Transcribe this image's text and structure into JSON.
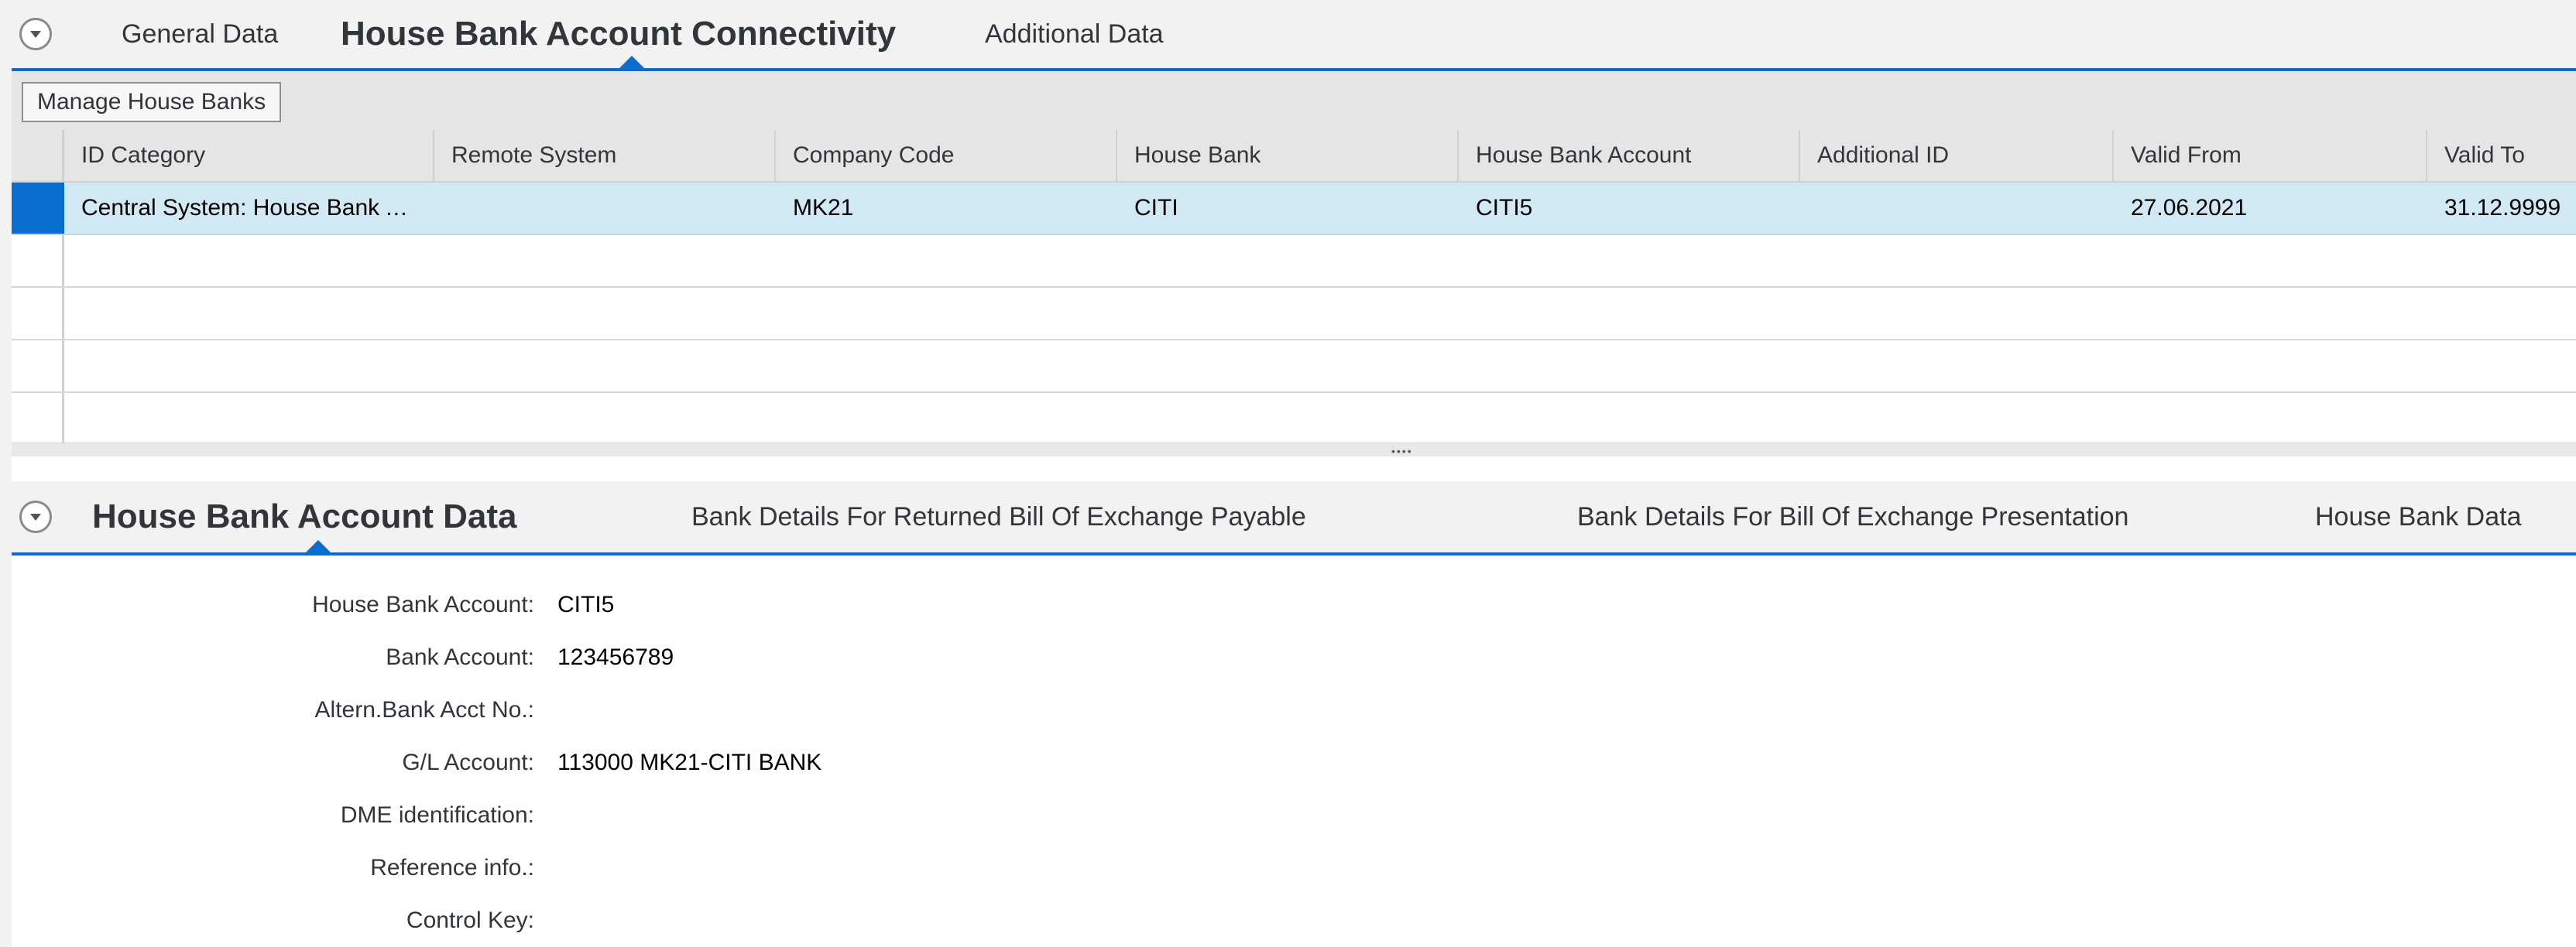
{
  "top_tabs": {
    "items": [
      {
        "label": "General Data"
      },
      {
        "label": "House Bank Account Connectivity"
      },
      {
        "label": "Additional Data"
      }
    ],
    "active_index": 1
  },
  "toolbar": {
    "manage_label": "Manage House Banks"
  },
  "table": {
    "columns": [
      "ID Category",
      "Remote System",
      "Company Code",
      "House Bank",
      "House Bank Account",
      "Additional ID",
      "Valid From",
      "Valid To"
    ],
    "rows": [
      [
        "Central System: House Bank Account",
        "",
        "MK21",
        "CITI",
        "CITI5",
        "",
        "27.06.2021",
        "31.12.9999"
      ]
    ],
    "selected_row": 0,
    "empty_rows": 4
  },
  "bottom_tabs": {
    "items": [
      {
        "label": "House Bank Account Data"
      },
      {
        "label": "Bank Details For Returned Bill Of Exchange Payable"
      },
      {
        "label": "Bank Details For Bill Of Exchange Presentation"
      },
      {
        "label": "House Bank Data"
      }
    ],
    "active_index": 0
  },
  "form": {
    "fields": [
      {
        "label": "House Bank Account:",
        "value": "CITI5"
      },
      {
        "label": "Bank Account:",
        "value": "123456789"
      },
      {
        "label": "Altern.Bank Acct No.:",
        "value": ""
      },
      {
        "label": "G/L Account:",
        "value": "113000 MK21-CITI BANK"
      },
      {
        "label": "DME identification:",
        "value": ""
      },
      {
        "label": "Reference info.:",
        "value": ""
      },
      {
        "label": "Control Key:",
        "value": ""
      }
    ]
  },
  "colors": {
    "accent": "#0a6ed1",
    "selected_row": "#d1e8f5",
    "header_bg": "#e5e5e5",
    "tabbar_bg": "#f2f2f2"
  },
  "icons": {
    "collapse": "collapse-icon",
    "splitter": "splitter-grip-icon"
  }
}
